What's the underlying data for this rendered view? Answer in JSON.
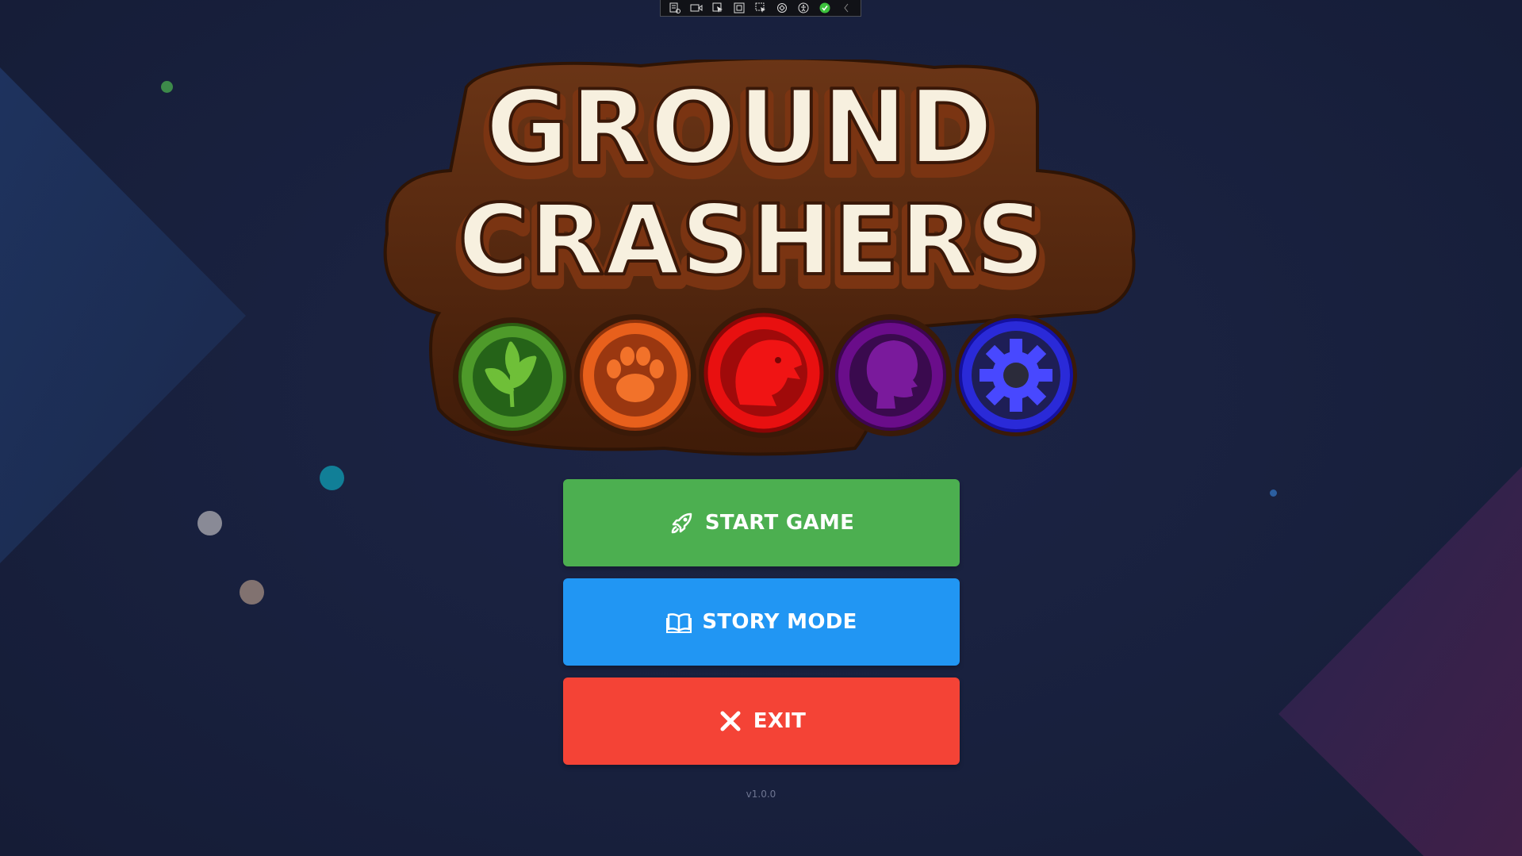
{
  "game": {
    "title_line1": "GROUND",
    "title_line2": "CRASHERS",
    "emblems": [
      {
        "name": "leaf-emblem",
        "color": "#4e9a2a"
      },
      {
        "name": "paw-emblem",
        "color": "#e8601c"
      },
      {
        "name": "beast-emblem",
        "color": "#e81010"
      },
      {
        "name": "head-profile-emblem",
        "color": "#6a0d8a"
      },
      {
        "name": "gear-emblem",
        "color": "#2a2ad8"
      }
    ]
  },
  "menu": {
    "start_label": "START GAME",
    "story_label": "STORY MODE",
    "exit_label": "EXIT",
    "start_icon": "rocket-icon",
    "story_icon": "book-icon",
    "exit_icon": "close-icon",
    "colors": {
      "start": "#4caf50",
      "story": "#2196f3",
      "exit": "#f44336"
    }
  },
  "version": "v1.0.0"
}
